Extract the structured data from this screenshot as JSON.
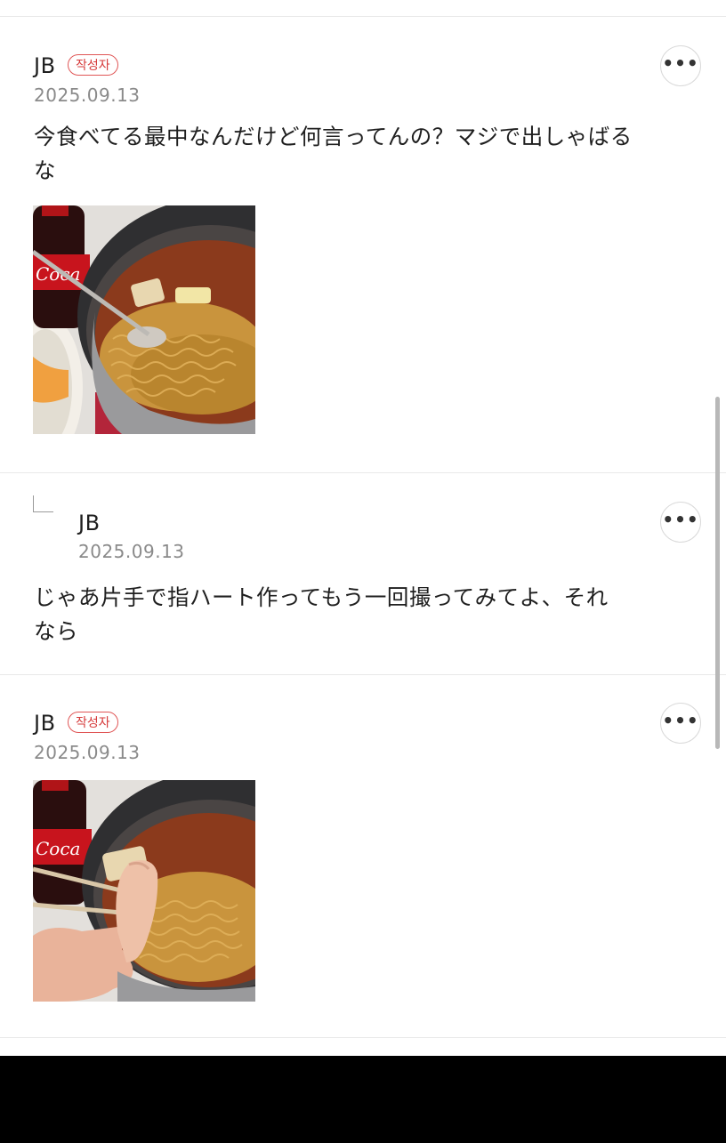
{
  "comments": [
    {
      "author": "JB",
      "badge": "작성자",
      "date": "2025.09.13",
      "text": "今食べてる最中なんだけど何言ってんの？マジで出しゃばる\nな",
      "photo_desc": "ramen-pot-photo"
    },
    {
      "author": "JB",
      "date": "2025.09.13",
      "text": "じゃあ片手で指ハート作ってもう一回撮ってみてよ、それ\nなら",
      "is_reply": true
    },
    {
      "author": "JB",
      "badge": "작성자",
      "date": "2025.09.13",
      "photo_desc": "ramen-finger-heart-photo"
    }
  ],
  "more_icon": "more-horizontal-icon",
  "more_label": "•••",
  "colors": {
    "badge": "#d63a3a",
    "date": "#8a8a8a",
    "divider": "#e9e9e9"
  }
}
